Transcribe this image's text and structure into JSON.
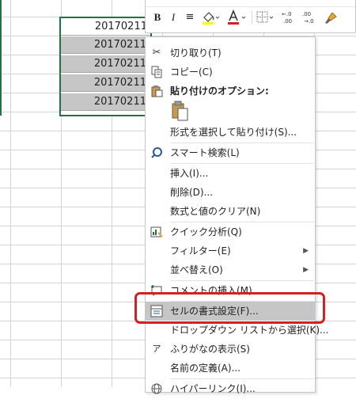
{
  "cells": [
    "20170211",
    "20170211",
    "20170211",
    "20170211",
    "20170211"
  ],
  "mini_toolbar": {
    "bold": "B",
    "italic": "I",
    "align": "≡",
    "font_color_letter": "A",
    "decimal_add": "←.0\n.00",
    "decimal_remove": ".00\n→.0"
  },
  "menu": {
    "cut": "切り取り(T)",
    "copy": "コピー(C)",
    "paste_options_heading": "貼り付けのオプション:",
    "paste_special": "形式を選択して貼り付け(S)...",
    "smart_lookup": "スマート検索(L)",
    "insert": "挿入(I)...",
    "delete": "削除(D)...",
    "clear_contents": "数式と値のクリア(N)",
    "quick_analysis": "クイック分析(Q)",
    "filter": "フィルター(E)",
    "sort": "並べ替え(O)",
    "insert_comment": "コメントの挿入(M)",
    "format_cells": "セルの書式設定(F)...",
    "pick_from_list": "ドロップダウン リストから選択(K)...",
    "show_phonetic": "ふりがなの表示(S)",
    "define_name": "名前の定義(A)...",
    "hyperlink": "ハイパーリンク(I)..."
  },
  "colors": {
    "highlight_fill": "#ffff00",
    "font_color": "#d32121",
    "selection_border": "#217346",
    "callout_border": "#d32121"
  }
}
